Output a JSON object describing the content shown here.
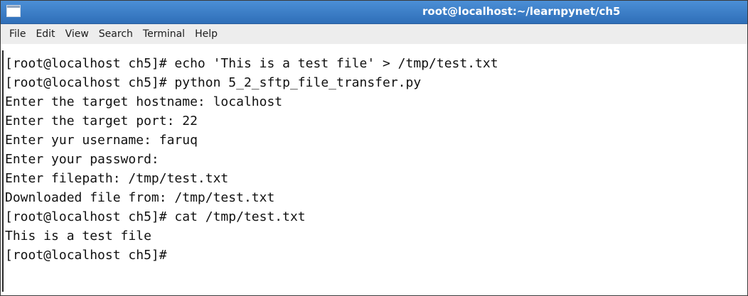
{
  "window": {
    "title": "root@localhost:~/learnpynet/ch5"
  },
  "menubar": {
    "items": [
      {
        "label": "File"
      },
      {
        "label": "Edit"
      },
      {
        "label": "View"
      },
      {
        "label": "Search"
      },
      {
        "label": "Terminal"
      },
      {
        "label": "Help"
      }
    ]
  },
  "terminal": {
    "lines": [
      "[root@localhost ch5]# echo 'This is a test file' > /tmp/test.txt",
      "[root@localhost ch5]# python 5_2_sftp_file_transfer.py",
      "Enter the target hostname: localhost",
      "Enter the target port: 22",
      "Enter yur username: faruq",
      "Enter your password:",
      "Enter filepath: /tmp/test.txt",
      "Downloaded file from: /tmp/test.txt",
      "[root@localhost ch5]# cat /tmp/test.txt",
      "This is a test file",
      "[root@localhost ch5]#"
    ]
  }
}
